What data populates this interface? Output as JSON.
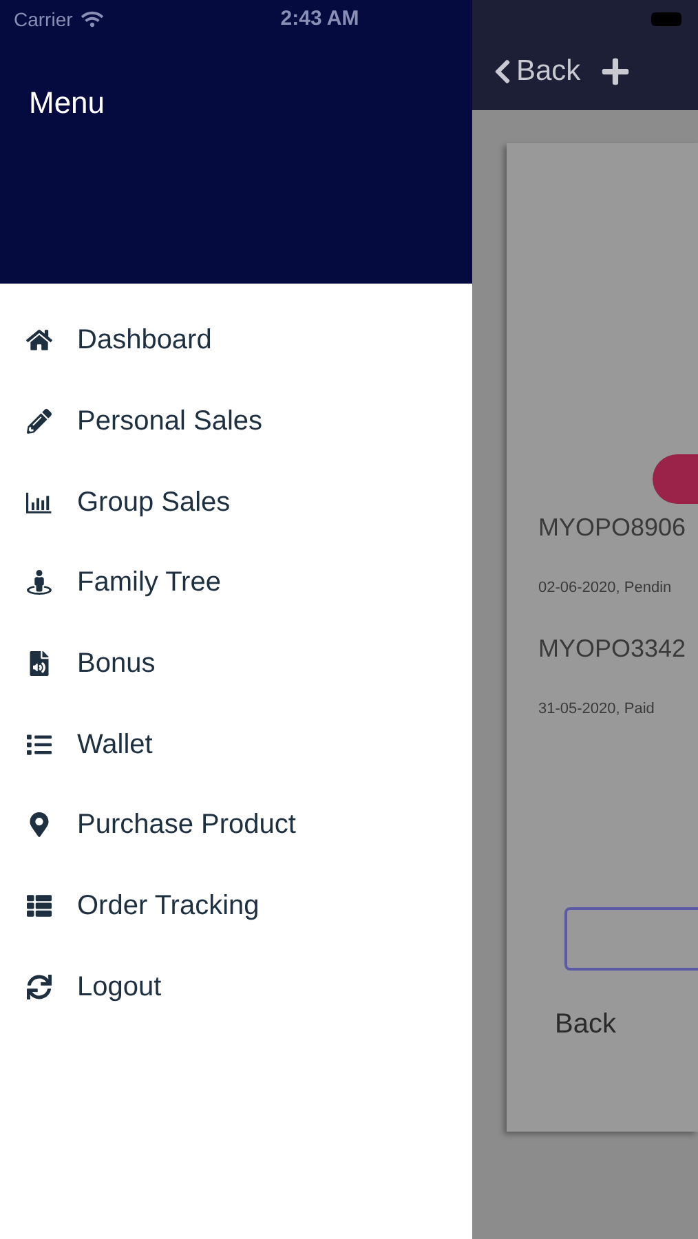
{
  "status_bar": {
    "carrier": "Carrier",
    "time": "2:43 AM"
  },
  "drawer": {
    "title": "Menu",
    "items": [
      {
        "label": "Dashboard"
      },
      {
        "label": "Personal Sales"
      },
      {
        "label": "Group Sales"
      },
      {
        "label": "Family Tree"
      },
      {
        "label": "Bonus"
      },
      {
        "label": "Wallet"
      },
      {
        "label": "Purchase Product"
      },
      {
        "label": "Order Tracking"
      },
      {
        "label": "Logout"
      }
    ]
  },
  "background_screen": {
    "nav_back": "Back",
    "orders": [
      {
        "number": "MYOPO8906",
        "detail": "02-06-2020, Pendin"
      },
      {
        "number": "MYOPO3342",
        "detail": "31-05-2020, Paid"
      }
    ],
    "back_label": "Back"
  }
}
